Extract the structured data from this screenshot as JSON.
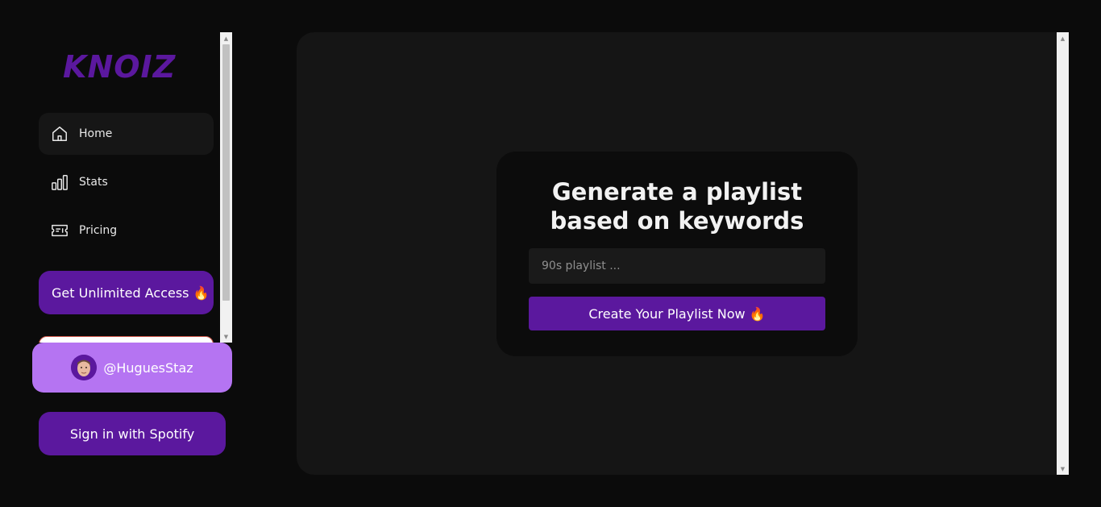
{
  "brand": {
    "logo_text": "KNOIZ"
  },
  "sidebar": {
    "nav": [
      {
        "label": "Home",
        "icon": "home-icon",
        "active": true
      },
      {
        "label": "Stats",
        "icon": "bar-chart-icon",
        "active": false
      },
      {
        "label": "Pricing",
        "icon": "ticket-icon",
        "active": false
      }
    ],
    "unlimited_label": "Get Unlimited Access 🔥"
  },
  "user": {
    "handle": "@HuguesStaz"
  },
  "auth": {
    "spotify_label": "Sign in with Spotify"
  },
  "generator": {
    "title_line1": "Generate a playlist",
    "title_line2": "based on keywords",
    "input_placeholder": "90s playlist ...",
    "input_value": "",
    "create_label": "Create Your Playlist Now 🔥"
  },
  "colors": {
    "accent": "#5b189e",
    "accent_light": "#b574f2",
    "background": "#0b0b0b",
    "panel": "#151515",
    "card": "#0c0c0c"
  }
}
